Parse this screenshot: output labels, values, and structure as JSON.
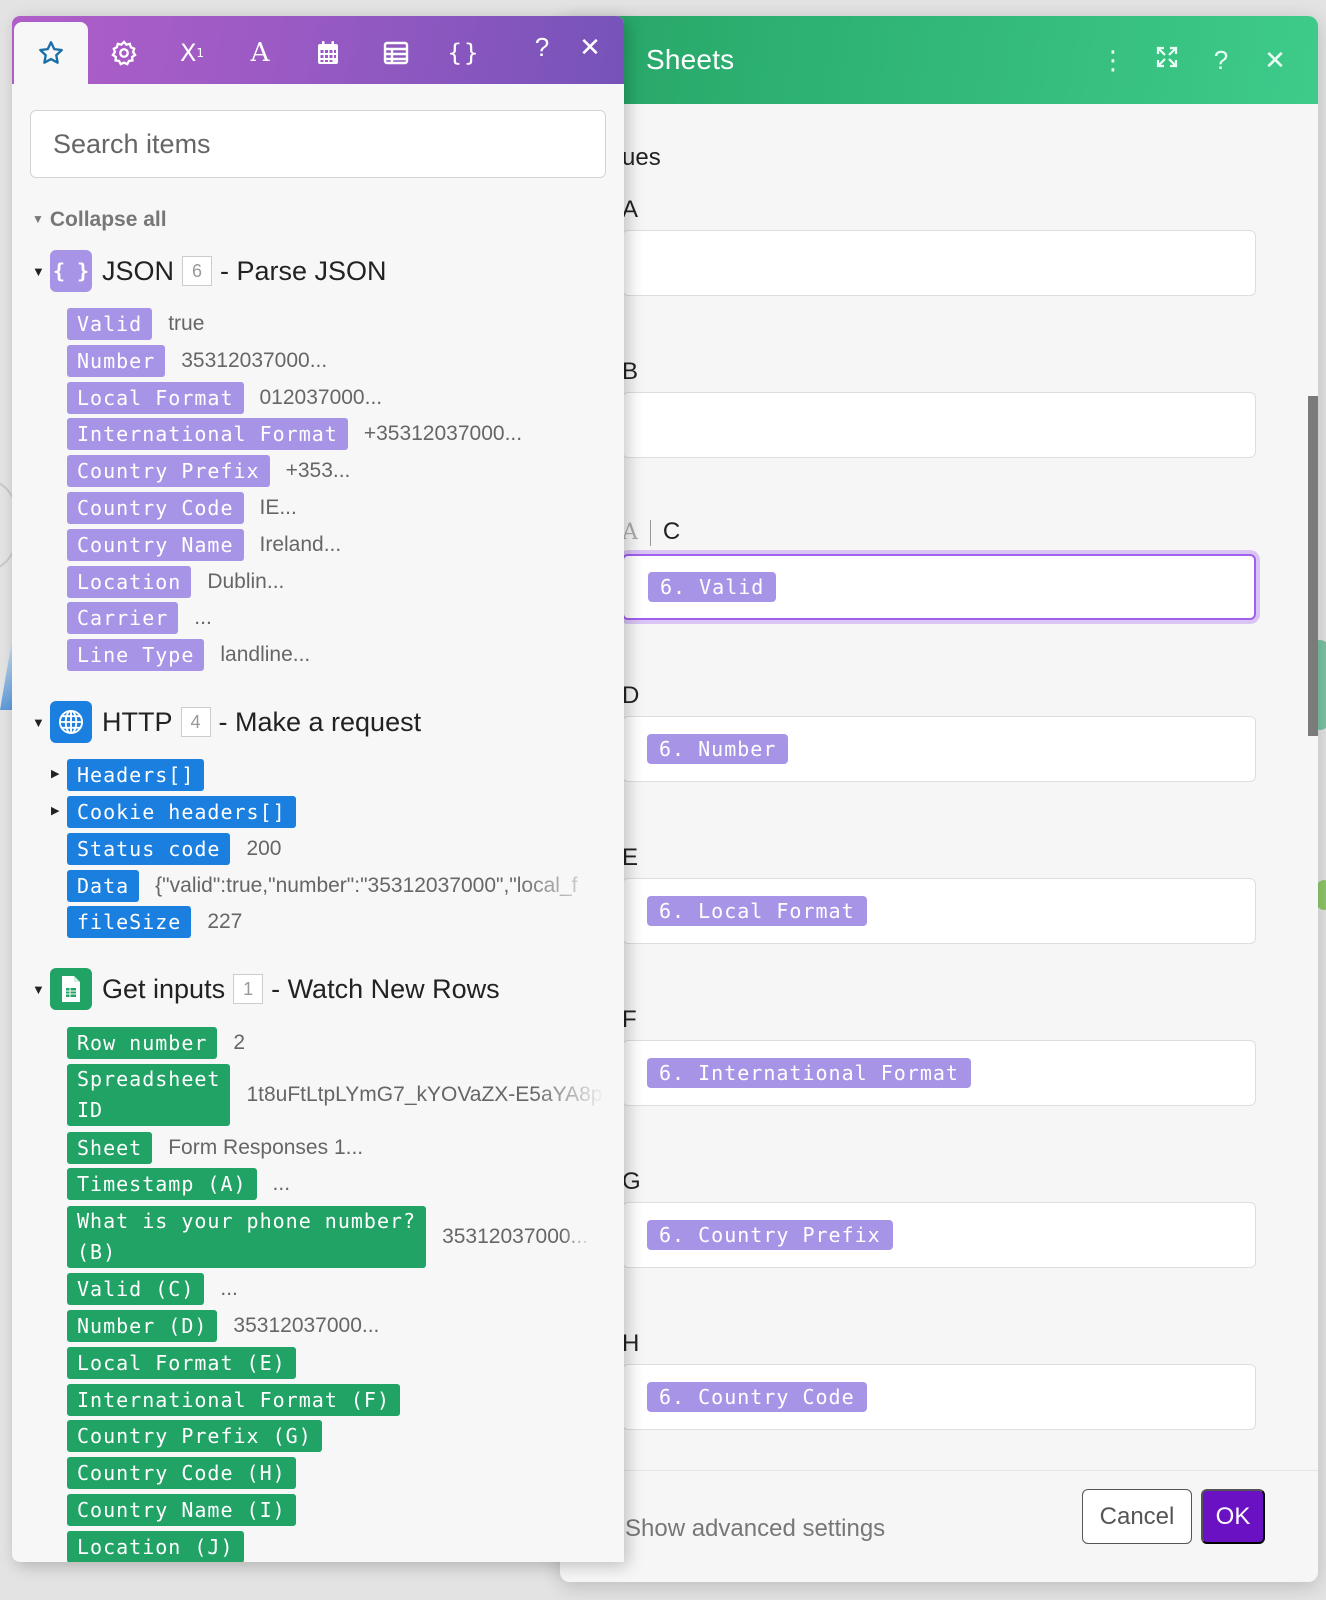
{
  "sheets_dialog": {
    "title": "Sheets",
    "header_icons": [
      "more-vertical-icon",
      "expand-icon",
      "help-icon",
      "close-icon"
    ],
    "section_fragment": "ues",
    "fields": [
      {
        "label": "A",
        "value": null
      },
      {
        "label": "B",
        "value": null
      },
      {
        "label": "C",
        "mode_indicator": "A",
        "value": "6. Valid",
        "active": true
      },
      {
        "label": "D",
        "value": "6. Number"
      },
      {
        "label": "E",
        "value": "6. Local Format"
      },
      {
        "label": "F",
        "value": "6. International Format"
      },
      {
        "label": "G",
        "value": "6. Country Prefix"
      },
      {
        "label": "H",
        "value": "6. Country Code"
      }
    ],
    "footer": {
      "advanced_link": "Show advanced settings",
      "cancel_label": "Cancel",
      "ok_label": "OK"
    },
    "colors": {
      "header_start": "#26a567",
      "header_end": "#3ecb8a",
      "ok_button": "#6a12c3"
    }
  },
  "mapping_panel": {
    "tabs": [
      {
        "icon": "star-icon",
        "active": true
      },
      {
        "icon": "gear-icon"
      },
      {
        "icon": "superscript-icon",
        "text": "X",
        "sup": "1"
      },
      {
        "icon": "text-icon",
        "text": "A"
      },
      {
        "icon": "calendar-icon"
      },
      {
        "icon": "table-icon"
      },
      {
        "icon": "braces-icon",
        "text": "{}"
      }
    ],
    "help_label": "?",
    "close_label": "✕",
    "search_placeholder": "Search items",
    "collapse_all": "Collapse all",
    "modules": [
      {
        "name": "JSON",
        "number": "6",
        "action": "- Parse JSON",
        "icon": "braces-icon",
        "icon_text": "{ }",
        "color": "#a894e6",
        "items": [
          {
            "label": "Valid",
            "value": "true"
          },
          {
            "label": "Number",
            "value": "35312037000..."
          },
          {
            "label": "Local Format",
            "value": "012037000..."
          },
          {
            "label": "International Format",
            "value": "+35312037000..."
          },
          {
            "label": "Country Prefix",
            "value": "+353..."
          },
          {
            "label": "Country Code",
            "value": "IE..."
          },
          {
            "label": "Country Name",
            "value": "Ireland..."
          },
          {
            "label": "Location",
            "value": "Dublin..."
          },
          {
            "label": "Carrier",
            "value": "..."
          },
          {
            "label": "Line Type",
            "value": "landline..."
          }
        ]
      },
      {
        "name": "HTTP",
        "number": "4",
        "action": "- Make a request",
        "icon": "globe-icon",
        "color": "#1b7fe0",
        "items": [
          {
            "label": "Headers[]",
            "value": "",
            "expandable": true
          },
          {
            "label": "Cookie headers[]",
            "value": "",
            "expandable": true
          },
          {
            "label": "Status code",
            "value": "200"
          },
          {
            "label": "Data",
            "value": "{\"valid\":true,\"number\":\"35312037000\",\"local_f"
          },
          {
            "label": "fileSize",
            "value": "227"
          }
        ]
      },
      {
        "name": "Get inputs",
        "number": "1",
        "action": "- Watch New Rows",
        "icon": "google-sheets-icon",
        "color": "#21a366",
        "items": [
          {
            "label": "Row number",
            "value": "2"
          },
          {
            "label_line1": "Spreadsheet",
            "label_line2": "ID",
            "value": "1t8uFtLtpLYmG7_kYOVaZX-E5aYA8p"
          },
          {
            "label": "Sheet",
            "value": "Form Responses 1..."
          },
          {
            "label": "Timestamp (A)",
            "value": "..."
          },
          {
            "label_line1": "What is your phone number?",
            "label_line2": "(B)",
            "value": "35312037000..."
          },
          {
            "label": "Valid (C)",
            "value": "..."
          },
          {
            "label": "Number (D)",
            "value": "35312037000..."
          },
          {
            "label": "Local Format (E)",
            "value": ""
          },
          {
            "label": "International Format (F)",
            "value": ""
          },
          {
            "label": "Country Prefix (G)",
            "value": ""
          },
          {
            "label": "Country Code (H)",
            "value": ""
          },
          {
            "label": "Country Name (I)",
            "value": ""
          },
          {
            "label": "Location (J)",
            "value": ""
          }
        ]
      }
    ]
  }
}
